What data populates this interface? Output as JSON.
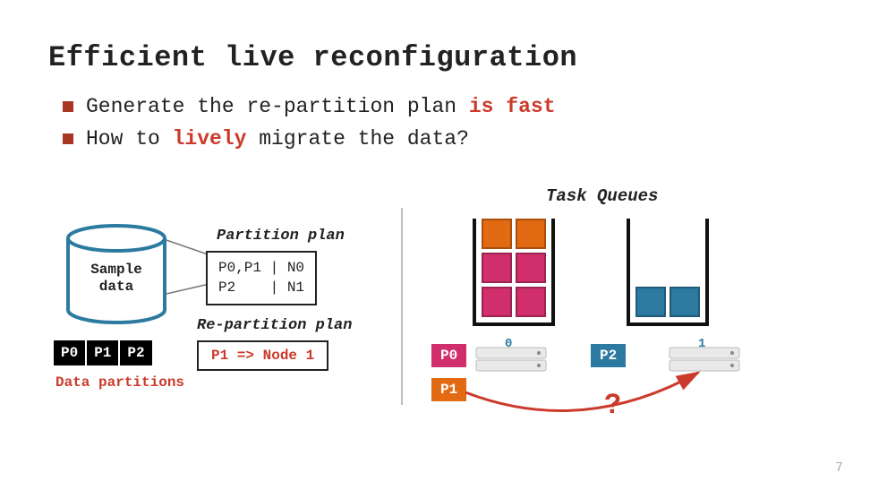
{
  "title": "Efficient live reconfiguration",
  "bullets": [
    {
      "pre": "Generate the re-partition plan ",
      "em": "is fast",
      "post": ""
    },
    {
      "pre": "How to ",
      "em": "lively",
      "post": " migrate the data?"
    }
  ],
  "cylinder": {
    "line1": "Sample",
    "line2": "data"
  },
  "plan": {
    "label": "Partition plan",
    "row1": "P0,P1 | N0",
    "row2": "P2    | N1"
  },
  "replan": {
    "label": "Re-partition plan",
    "text": "P1 => Node 1"
  },
  "dp": {
    "p0": "P0",
    "p1": "P1",
    "p2": "P2",
    "caption": "Data partitions"
  },
  "right": {
    "tq_label": "Task Queues",
    "node0": "0",
    "node1": "1",
    "badge_p0": "P0",
    "badge_p1": "P1",
    "badge_p2": "P2",
    "qmark": "?"
  },
  "task_colors": {
    "q0": [
      "orange",
      "orange",
      "magenta",
      "magenta",
      "magenta",
      "magenta"
    ],
    "q1": [
      "teal",
      "teal"
    ]
  },
  "page_number": "7"
}
